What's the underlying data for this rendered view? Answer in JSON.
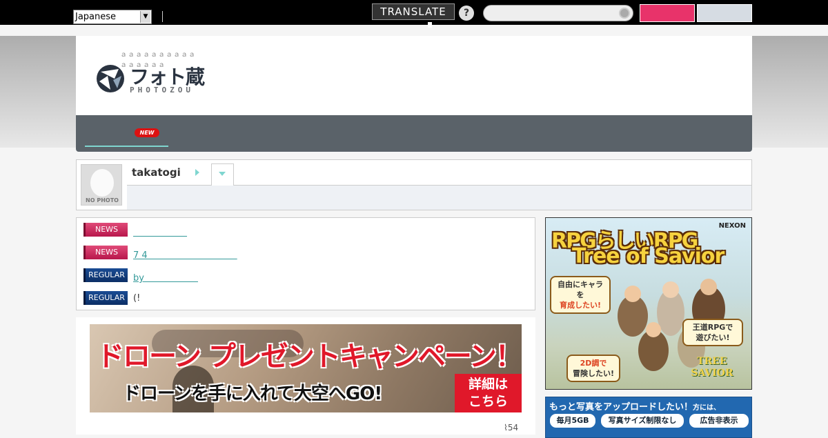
{
  "topbar": {
    "language_select": "Japanese",
    "translate_label": "TRANSLATE",
    "help_label": "?"
  },
  "header": {
    "tagline": "ａａａａａａａａａａａａａａａａ",
    "logo_text_jp": "フォト蔵",
    "logo_text_en": "PHOTOZOU"
  },
  "nav": {
    "new_badge": "NEW"
  },
  "user": {
    "username": "takatogi",
    "avatar_label": "NO PHOTO"
  },
  "news": [
    {
      "badge": "NEWS",
      "type": "news",
      "text": "　　　　　　"
    },
    {
      "badge": "NEWS",
      "type": "news",
      "text": "7 4　　　　　　　　　　"
    },
    {
      "badge": "REGULAR",
      "type": "regular",
      "text": "by　　　　　　"
    },
    {
      "badge": "REGULAR",
      "type": "regular",
      "text": "(!"
    }
  ],
  "banner": {
    "title": "ドローン プレゼントキャンペーン！",
    "subtitle": "ドローンを手に入れて大空へGO!",
    "button_line1": "詳細は",
    "button_line2": "こちら",
    "clip_count": "54"
  },
  "ad_tos": {
    "title_line1": "RPGらしいRPG",
    "title_line2": "Tree of Savior",
    "brand": "NEXON",
    "bubble1_line1": "自由にキャラを",
    "bubble1_line2": "育成したい!",
    "bubble2_line1": "王道RPGで",
    "bubble2_line2": "遊びたい!",
    "bubble3_line1": "2D調で",
    "bubble3_line2": "冒険したい!",
    "logo_line1": "TREE",
    "logo_line2": "SAVIOR"
  },
  "ad_upload": {
    "title": "もっと写真をアップロードしたい！",
    "title_suffix": "方には、",
    "tag1": "毎月5GB",
    "tag2": "写真サイズ制限なし",
    "tag3": "広告非表示"
  },
  "colors": {
    "topbar": "#000000",
    "nav": "#5a6269",
    "accent_teal": "#7fd6d0",
    "news_badge": "#c81d55",
    "regular_badge": "#0e3a7c",
    "signup_button": "#e8336a"
  }
}
